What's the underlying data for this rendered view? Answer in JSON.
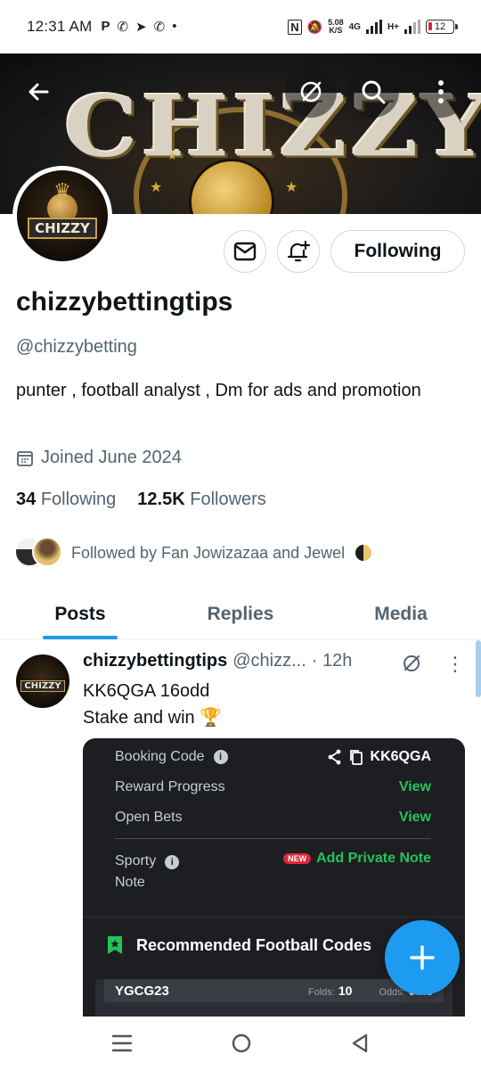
{
  "status_bar": {
    "time": "12:31 AM",
    "app_icons": [
      "P",
      "whatsapp",
      "telegram",
      "whatsapp",
      "•"
    ],
    "speed_value": "5.08",
    "speed_unit": "K/S",
    "network": "4G",
    "network2": "H+",
    "battery": "12"
  },
  "banner": {
    "word": "CHIZZY"
  },
  "profile": {
    "display_name": "chizzybettingtips",
    "handle": "@chizzybetting",
    "bio": "punter , football analyst , Dm for ads and promotion",
    "joined": "Joined June 2024",
    "following_count": "34",
    "following_label": "Following",
    "followers_count": "12.5K",
    "followers_label": "Followers",
    "followed_by": "Followed by Fan Jowizazaa and Jewel",
    "avatar_text": "CHIZZY",
    "follow_button": "Following"
  },
  "tabs": [
    {
      "label": "Posts",
      "active": true
    },
    {
      "label": "Replies",
      "active": false
    },
    {
      "label": "Media",
      "active": false
    }
  ],
  "post": {
    "name": "chizzybettingtips",
    "handle": "@chizz...",
    "time": "· 12h",
    "line1": "KK6QGA 16odd",
    "line2": "Stake and win",
    "avatar_text": "CHIZZY",
    "embed": {
      "booking_label": "Booking Code",
      "booking_code": "KK6QGA",
      "reward_label": "Reward Progress",
      "reward_value": "View",
      "openbets_label": "Open Bets",
      "openbets_value": "View",
      "note_label1": "Sporty",
      "note_label2": "Note",
      "new_badge": "NEW",
      "note_action": "Add Private Note",
      "rec_title": "Recommended Football Codes",
      "code": "YGCG23",
      "folds_label": "Folds:",
      "folds_value": "10",
      "odds_label": "Odds:",
      "odds_value": "95.5"
    }
  },
  "colors": {
    "accent": "#1d9bf0",
    "green": "#24c35a",
    "muted": "#536471"
  }
}
